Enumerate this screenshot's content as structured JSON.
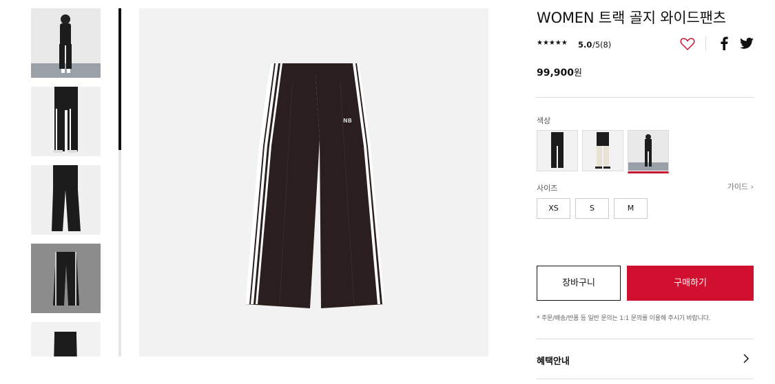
{
  "product": {
    "title": "WOMEN 트랙 골지 와이드팬츠",
    "stars": "★★★★★",
    "rating_score": "5.0",
    "rating_total": "/5",
    "rating_count": "(8)",
    "price_value": "99,900",
    "price_unit": "원"
  },
  "options": {
    "color_label": "색상",
    "size_label": "사이즈",
    "size_guide": "가이드 ›",
    "sizes": [
      "XS",
      "S",
      "M"
    ],
    "colors": [
      "black-model",
      "cream-model",
      "black-model-selected"
    ]
  },
  "actions": {
    "cart": "장바구니",
    "buy": "구매하기",
    "notice": "* 주문/배송/반품 등 일반 문의는 1:1 문의를 이용해 주시기 바랍니다."
  },
  "benefit": {
    "label": "혜택안내"
  },
  "colors": {
    "accent": "#d0102e",
    "heart": "#c8102e",
    "image_bg": "#f2f2f2"
  },
  "icons": [
    "heart-icon",
    "facebook-icon",
    "twitter-icon",
    "chevron-right-icon"
  ]
}
